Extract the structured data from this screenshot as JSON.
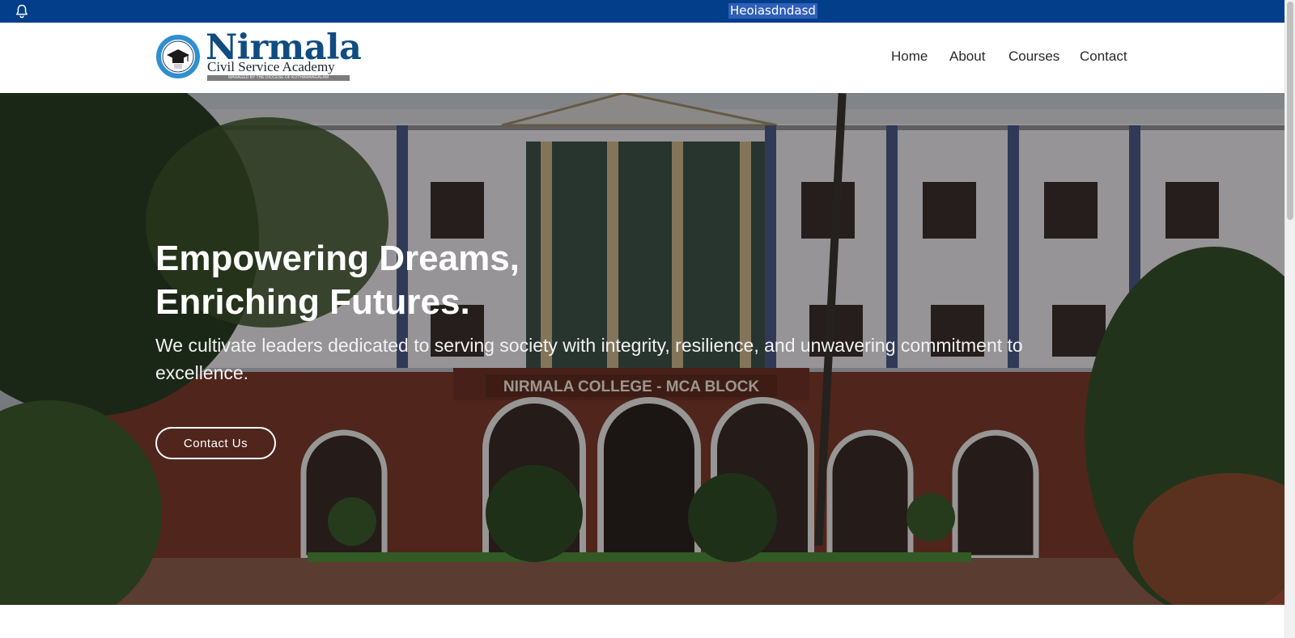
{
  "announcement": {
    "text": "Heoiasdndasd"
  },
  "brand": {
    "name": "Nirmala",
    "tagline": "Civil Service Academy",
    "strip": "MANAGED BY THE DIOCESE OF KOTHAMANGALAM",
    "seal_text": "NIRMALA",
    "primary_color": "#0f4c81"
  },
  "nav": {
    "items": [
      {
        "label": "Home"
      },
      {
        "label": "About"
      },
      {
        "label": "Courses"
      },
      {
        "label": "Contact"
      }
    ]
  },
  "hero": {
    "title_line1": "Empowering Dreams,",
    "title_line2": "Enriching Futures.",
    "subtitle": "We cultivate leaders dedicated to serving society with integrity, resilience, and unwavering commitment to excellence.",
    "cta_label": "Contact Us",
    "building_sign": "NIRMALA COLLEGE - MCA BLOCK"
  },
  "icons": {
    "bell": "bell-icon"
  },
  "colors": {
    "top_bar": "#023e8a",
    "highlight": "#2e5fb8"
  }
}
